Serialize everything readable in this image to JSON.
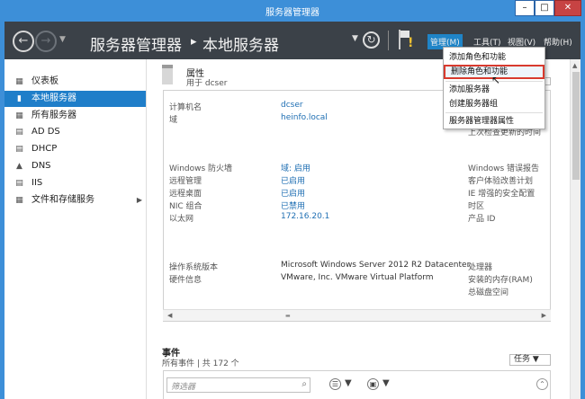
{
  "window": {
    "title": "服务器管理器",
    "min_glyph": "–",
    "max_glyph": "□",
    "close_glyph": "✕"
  },
  "header": {
    "back_glyph": "←",
    "forward_glyph": "→",
    "breadcrumb_root": "服务器管理器",
    "breadcrumb_separator": "▸",
    "breadcrumb_current": "本地服务器",
    "refresh_glyph": "↻",
    "warning_glyph": "!",
    "menus": {
      "manage": "管理(M)",
      "tools": "工具(T)",
      "view": "视图(V)",
      "help": "帮助(H)"
    }
  },
  "sidebar": {
    "items": [
      {
        "label": "仪表板",
        "icon": "▦"
      },
      {
        "label": "本地服务器",
        "icon": "▮",
        "active": true
      },
      {
        "label": "所有服务器",
        "icon": "▦"
      },
      {
        "label": "AD DS",
        "icon": "▤"
      },
      {
        "label": "DHCP",
        "icon": "▤"
      },
      {
        "label": "DNS",
        "icon": "▲"
      },
      {
        "label": "IIS",
        "icon": "▤"
      },
      {
        "label": "文件和存储服务",
        "icon": "▦",
        "expandable": true
      }
    ],
    "arrow_glyph": "▶"
  },
  "properties": {
    "title": "属性",
    "subtitle": "用于 dcser",
    "rows_top": [
      {
        "label": "计算机名",
        "value": "dcser"
      },
      {
        "label": "域",
        "value": "heinfo.local"
      }
    ],
    "right_top_label": "上次检查更新的时间",
    "rows_mid": [
      {
        "label": "Windows 防火墙",
        "value": "域: 启用"
      },
      {
        "label": "远程管理",
        "value": "已启用"
      },
      {
        "label": "远程桌面",
        "value": "已启用"
      },
      {
        "label": "NIC 组合",
        "value": "已禁用"
      },
      {
        "label": "以太网",
        "value": "172.16.20.1"
      }
    ],
    "right_mid": [
      "Windows 错误报告",
      "客户体验改善计划",
      "IE 增强的安全配置",
      "时区",
      "产品 ID"
    ],
    "rows_bottom": [
      {
        "label": "操作系统版本",
        "value": "Microsoft Windows Server 2012 R2 Datacenter"
      },
      {
        "label": "硬件信息",
        "value": "VMware, Inc. VMware Virtual Platform"
      }
    ],
    "right_bottom": [
      "处理器",
      "安装的内存(RAM)",
      "总磁盘空间"
    ]
  },
  "events": {
    "title": "事件",
    "count": "所有事件 | 共 172 个",
    "tasks_label": "任务 ▼",
    "filter_placeholder": "筛选器",
    "filter_icon": "⌕",
    "list_icon": "☰",
    "save_icon": "▣",
    "caret": "▼",
    "expand_glyph": "⌃"
  },
  "manage_menu": {
    "items": [
      "添加角色和功能",
      "删除角色和功能",
      "添加服务器",
      "创建服务器组",
      "服务器管理器属性"
    ]
  }
}
